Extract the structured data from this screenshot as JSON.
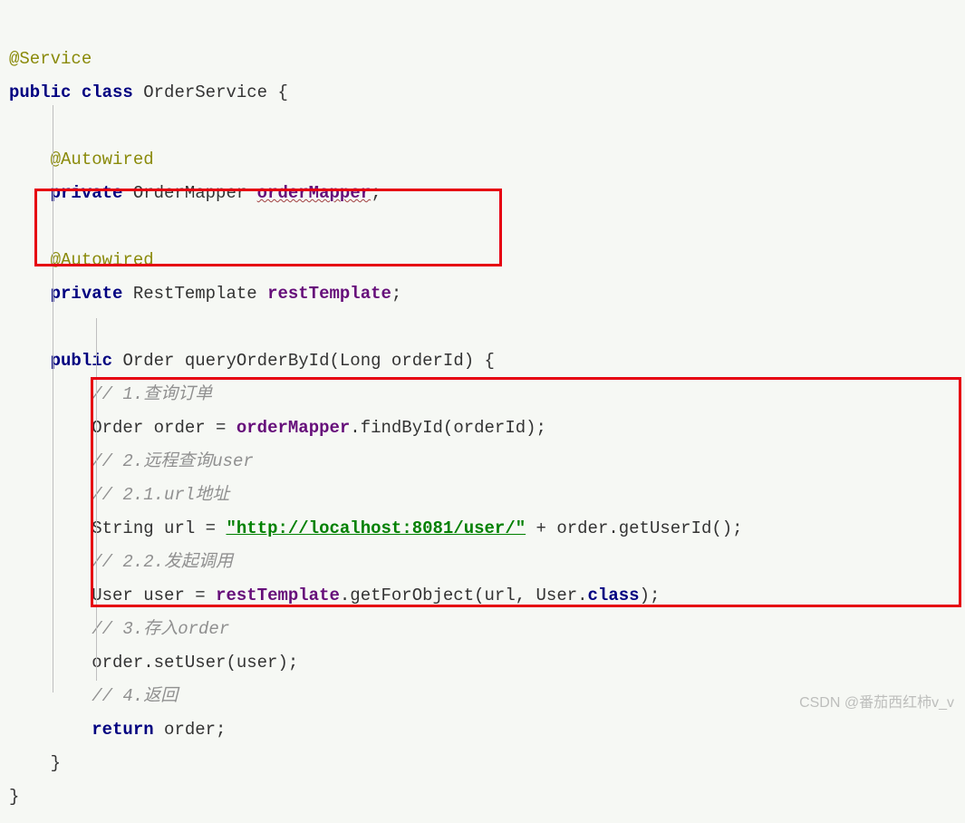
{
  "code": {
    "ann_service": "@Service",
    "kw_public": "public",
    "kw_class": "class",
    "cls_name": "OrderService",
    "brace_open": "{",
    "ann_autowired": "@Autowired",
    "kw_private": "private",
    "type_mapper": "OrderMapper",
    "field_mapper": "orderMapper",
    "semicolon": ";",
    "type_rest": "RestTemplate",
    "field_rest": "restTemplate",
    "type_order": "Order",
    "method_name": "queryOrderById",
    "type_long": "Long",
    "param_name": "orderId",
    "paren_close_brace": ") {",
    "c1": "// 1.查询订单",
    "var_order": "order",
    "eq": " = ",
    "call_findById": ".findById(orderId);",
    "c2": "// 2.远程查询user",
    "c21": "// 2.1.url地址",
    "type_string": "String",
    "var_url": "url",
    "str_url": "\"http://localhost:8081/user/\"",
    "plus_get": " + order.getUserId();",
    "c22": "// 2.2.发起调用",
    "type_user": "User",
    "var_user": "user",
    "call_getFor": ".getForObject(url, User.",
    "kw_classref": "class",
    "tail_paren": ");",
    "c3": "// 3.存入order",
    "set_user": "order.setUser(user);",
    "c4": "// 4.返回",
    "kw_return": "return",
    "ret_val": " order;",
    "brace_close": "}"
  },
  "watermark": "CSDN @番茄西红柿v_v"
}
